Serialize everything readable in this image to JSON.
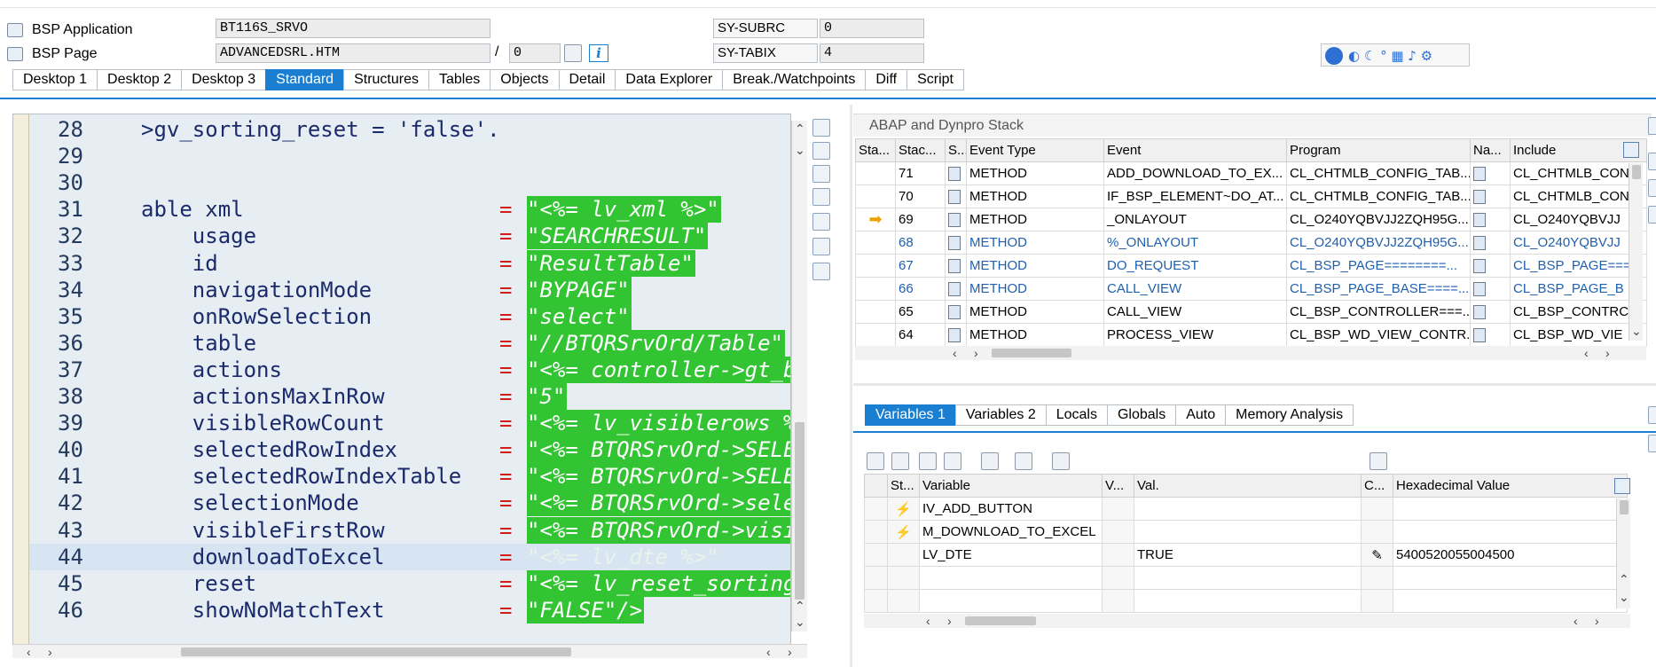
{
  "header": {
    "bsp_application_label": "BSP Application",
    "bsp_application_value": "BT116S_SRVO",
    "bsp_page_label": "BSP Page",
    "bsp_page_value": "ADVANCEDSRL.HTM",
    "page_sep": "/",
    "page_num": "0",
    "sy_subrc_label": "SY-SUBRC",
    "sy_subrc_value": "0",
    "sy_tabix_label": "SY-TABIX",
    "sy_tabix_value": "4",
    "info_label": "i"
  },
  "tabs": [
    "Desktop 1",
    "Desktop 2",
    "Desktop 3",
    "Standard",
    "Structures",
    "Tables",
    "Objects",
    "Detail",
    "Data Explorer",
    "Break./Watchpoints",
    "Diff",
    "Script"
  ],
  "active_tab": "Standard",
  "editor": {
    "lines": [
      {
        "n": "28",
        "kw": ">gv_sorting_reset = 'false'.",
        "eq": "",
        "val": "",
        "style": "first"
      },
      {
        "n": "29",
        "kw": "",
        "eq": "",
        "val": ""
      },
      {
        "n": "30",
        "kw": "",
        "eq": "",
        "val": ""
      },
      {
        "n": "31",
        "kw": "able xml",
        "eq": "=",
        "val": "\"<%= lv_xml %>\""
      },
      {
        "n": "32",
        "kw": "    usage",
        "eq": "=",
        "val": "\"SEARCHRESULT\""
      },
      {
        "n": "33",
        "kw": "    id",
        "eq": "=",
        "val": "\"ResultTable\""
      },
      {
        "n": "34",
        "kw": "    navigationMode",
        "eq": "=",
        "val": "\"BYPAGE\""
      },
      {
        "n": "35",
        "kw": "    onRowSelection",
        "eq": "=",
        "val": "\"select\""
      },
      {
        "n": "36",
        "kw": "    table",
        "eq": "=",
        "val": "\"//BTQRSrvOrd/Table\""
      },
      {
        "n": "37",
        "kw": "    actions",
        "eq": "=",
        "val": "\"<%= controller->gt_b"
      },
      {
        "n": "38",
        "kw": "    actionsMaxInRow",
        "eq": "=",
        "val": "\"5\""
      },
      {
        "n": "39",
        "kw": "    visibleRowCount",
        "eq": "=",
        "val": "\"<%= lv_visiblerows %"
      },
      {
        "n": "40",
        "kw": "    selectedRowIndex",
        "eq": "=",
        "val": "\"<%= BTQRSrvOrd->SELE"
      },
      {
        "n": "41",
        "kw": "    selectedRowIndexTable",
        "eq": "=",
        "val": "\"<%= BTQRSrvOrd->SELE"
      },
      {
        "n": "42",
        "kw": "    selectionMode",
        "eq": "=",
        "val": "\"<%= BTQRSrvOrd->sele"
      },
      {
        "n": "43",
        "kw": "    visibleFirstRow",
        "eq": "=",
        "val": "\"<%= BTQRSrvOrd->visi"
      },
      {
        "n": "44",
        "kw": "    downloadToExcel",
        "eq": "=",
        "val": "\"<%= lv_dte %>\"",
        "style": "cur"
      },
      {
        "n": "45",
        "kw": "    reset",
        "eq": "=",
        "val": "\"<%= lv_reset_sorting"
      },
      {
        "n": "46",
        "kw": "    showNoMatchText",
        "eq": "=",
        "val": "\"FALSE\"/>"
      }
    ]
  },
  "stack": {
    "title": "ABAP and Dynpro Stack",
    "columns": [
      "Sta...",
      "Stac...",
      "S...",
      "Event Type",
      "Event",
      "Program",
      "Na...",
      "Include"
    ],
    "rows": [
      {
        "level": "71",
        "type": "METHOD",
        "event": "ADD_DOWNLOAD_TO_EX...",
        "program": "CL_CHTMLB_CONFIG_TAB...",
        "include": "CL_CHTMLB_CON",
        "cls": ""
      },
      {
        "level": "70",
        "type": "METHOD",
        "event": "IF_BSP_ELEMENT~DO_AT...",
        "program": "CL_CHTMLB_CONFIG_TAB...",
        "include": "CL_CHTMLB_CON",
        "cls": ""
      },
      {
        "level": "69",
        "type": "METHOD",
        "event": "_ONLAYOUT",
        "program": "CL_O240YQBVJJ2ZQH95G...",
        "include": "CL_O240YQBVJJ",
        "cls": "",
        "current": true
      },
      {
        "level": "68",
        "type": "METHOD",
        "event": "%_ONLAYOUT",
        "program": "CL_O240YQBVJJ2ZQH95G...",
        "include": "CL_O240YQBVJJ",
        "cls": "blue"
      },
      {
        "level": "67",
        "type": "METHOD",
        "event": "DO_REQUEST",
        "program": "CL_BSP_PAGE========...",
        "include": "CL_BSP_PAGE===",
        "cls": "blue"
      },
      {
        "level": "66",
        "type": "METHOD",
        "event": "CALL_VIEW",
        "program": "CL_BSP_PAGE_BASE====...",
        "include": "CL_BSP_PAGE_B",
        "cls": "blue"
      },
      {
        "level": "65",
        "type": "METHOD",
        "event": "CALL_VIEW",
        "program": "CL_BSP_CONTROLLER===...",
        "include": "CL_BSP_CONTRC",
        "cls": ""
      },
      {
        "level": "64",
        "type": "METHOD",
        "event": "PROCESS_VIEW",
        "program": "CL_BSP_WD_VIEW_CONTR...",
        "include": "CL_BSP_WD_VIE",
        "cls": ""
      }
    ]
  },
  "var_tabs": [
    "Variables 1",
    "Variables 2",
    "Locals",
    "Globals",
    "Auto",
    "Memory Analysis"
  ],
  "active_var_tab": "Variables 1",
  "variables": {
    "columns": [
      "St...",
      "Variable",
      "V...",
      "Val.",
      "C...",
      "Hexadecimal Value"
    ],
    "rows": [
      {
        "name": "IV_ADD_BUTTON",
        "val": "",
        "hex": "",
        "icon": "lightning"
      },
      {
        "name": "M_DOWNLOAD_TO_EXCEL",
        "val": "",
        "hex": "",
        "icon": "lightning"
      },
      {
        "name": "LV_DTE",
        "val": "TRUE",
        "hex": "5400520055004500",
        "icon": ""
      },
      {
        "name": "",
        "val": "",
        "hex": "",
        "icon": ""
      },
      {
        "name": "",
        "val": "",
        "hex": "",
        "icon": ""
      }
    ]
  },
  "colors": {
    "accent": "#1a7fd1",
    "highlight": "#33c433",
    "keyword": "#1b2a6b",
    "operator": "#d21d1d"
  }
}
